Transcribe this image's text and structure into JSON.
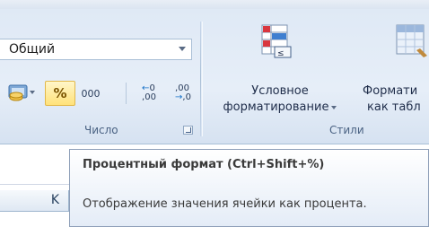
{
  "number_group": {
    "format_combo_value": "Общий",
    "percent_label": "%",
    "thousands_label": "000",
    "increase_decimal": {
      "top": "0",
      "bottom": ",00"
    },
    "decrease_decimal": {
      "top": ",00",
      "bottom": ",0"
    },
    "group_label": "Число"
  },
  "styles_group": {
    "conditional_formatting": {
      "line1": "Условное",
      "line2": "форматирование"
    },
    "format_as_table": {
      "line1": "Формати",
      "line2": "как табл"
    },
    "group_label": "Стили"
  },
  "sheet": {
    "column_label": "K"
  },
  "tooltip": {
    "title": "Процентный формат (Ctrl+Shift+%)",
    "body": "Отображение значения ячейки как процента."
  },
  "colors": {
    "ribbon": "#dfe9f5",
    "percent_highlight": "#ffe27a",
    "tooltip_border": "#8e9fb8"
  },
  "icons": [
    "currency-format-icon",
    "conditional-formatting-icon",
    "format-as-table-icon",
    "dialog-launcher-icon"
  ]
}
